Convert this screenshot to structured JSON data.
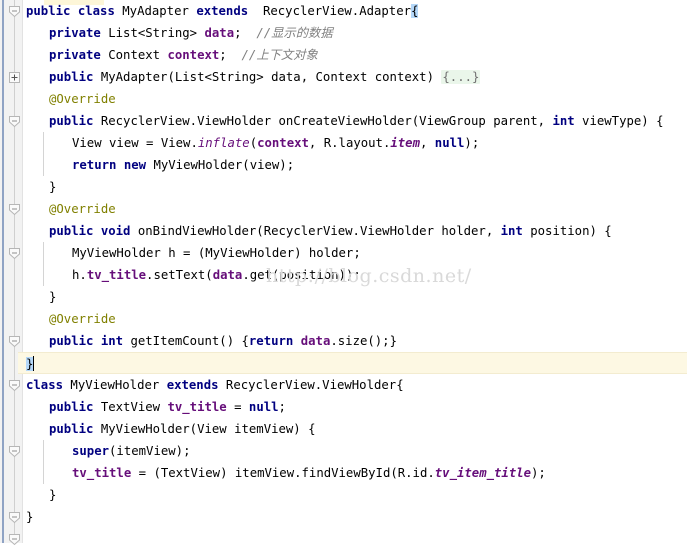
{
  "app": {
    "name": "code-editor",
    "language": "Java",
    "file_kind": "java-source"
  },
  "watermark": {
    "text": "http://blog.csdn.net/"
  },
  "gutter": {
    "fold_markers": [
      {
        "type": "expanded",
        "line": 0
      },
      {
        "type": "collapsed",
        "line": 3
      },
      {
        "type": "expanded",
        "line": 5
      },
      {
        "type": "expanded",
        "line": 9
      },
      {
        "type": "expanded",
        "line": 11
      },
      {
        "type": "expanded",
        "line": 15
      },
      {
        "type": "expanded",
        "line": 17
      },
      {
        "type": "expanded",
        "line": 20
      },
      {
        "type": "expanded",
        "line": 23
      },
      {
        "type": "expanded",
        "line": 24
      }
    ]
  },
  "code": {
    "caret_line_index": 17,
    "lines": [
      {
        "id": "l0",
        "indent": 0,
        "tokens": [
          {
            "t": "public",
            "c": "kw"
          },
          {
            "t": " ",
            "c": "pln"
          },
          {
            "t": "class",
            "c": "kw"
          },
          {
            "t": " ",
            "c": "pln"
          },
          {
            "t": "MyAdapter",
            "c": "pln"
          },
          {
            "t": " ",
            "c": "pln"
          },
          {
            "t": "extends",
            "c": "kw"
          },
          {
            "t": "  ",
            "c": "pln"
          },
          {
            "t": "RecyclerView.Adapter",
            "c": "pln"
          },
          {
            "t": "{",
            "c": "sel-brace"
          }
        ]
      },
      {
        "id": "l1",
        "indent": 1,
        "tokens": [
          {
            "t": "private",
            "c": "kw"
          },
          {
            "t": " List<String> ",
            "c": "pln"
          },
          {
            "t": "data",
            "c": "fld"
          },
          {
            "t": ";  ",
            "c": "pln"
          },
          {
            "t": "//显示的数据",
            "c": "cmt"
          }
        ]
      },
      {
        "id": "l2",
        "indent": 1,
        "tokens": [
          {
            "t": "private",
            "c": "kw"
          },
          {
            "t": " Context ",
            "c": "pln"
          },
          {
            "t": "context",
            "c": "fld"
          },
          {
            "t": ";  ",
            "c": "pln"
          },
          {
            "t": "//上下文对象",
            "c": "cmt"
          }
        ]
      },
      {
        "id": "l3",
        "indent": 1,
        "tokens": [
          {
            "t": "public",
            "c": "kw"
          },
          {
            "t": " MyAdapter(List<String> data, Context context) ",
            "c": "pln"
          },
          {
            "t": "{...}",
            "c": "fold-inline"
          }
        ]
      },
      {
        "id": "l4",
        "indent": 1,
        "tokens": [
          {
            "t": "@Override",
            "c": "ann"
          }
        ]
      },
      {
        "id": "l5",
        "indent": 1,
        "tokens": [
          {
            "t": "public",
            "c": "kw"
          },
          {
            "t": " RecyclerView.ViewHolder onCreateViewHolder(ViewGroup parent, ",
            "c": "pln"
          },
          {
            "t": "int",
            "c": "kw"
          },
          {
            "t": " viewType) {",
            "c": "pln"
          }
        ]
      },
      {
        "id": "l6",
        "indent": 2,
        "tokens": [
          {
            "t": "View view = View.",
            "c": "pln"
          },
          {
            "t": "inflate",
            "c": "sfi"
          },
          {
            "t": "(",
            "c": "pln"
          },
          {
            "t": "context",
            "c": "fld"
          },
          {
            "t": ", R.layout.",
            "c": "pln"
          },
          {
            "t": "item",
            "c": "fldi"
          },
          {
            "t": ", ",
            "c": "pln"
          },
          {
            "t": "null",
            "c": "kw"
          },
          {
            "t": ");",
            "c": "pln"
          }
        ]
      },
      {
        "id": "l7",
        "indent": 2,
        "tokens": [
          {
            "t": "return",
            "c": "kw"
          },
          {
            "t": " ",
            "c": "pln"
          },
          {
            "t": "new",
            "c": "kw"
          },
          {
            "t": " MyViewHolder(view);",
            "c": "pln"
          }
        ]
      },
      {
        "id": "l8",
        "indent": 1,
        "tokens": [
          {
            "t": "}",
            "c": "pln"
          }
        ]
      },
      {
        "id": "l9",
        "indent": 1,
        "tokens": [
          {
            "t": "@Override",
            "c": "ann"
          }
        ]
      },
      {
        "id": "l10",
        "indent": 1,
        "tokens": [
          {
            "t": "public",
            "c": "kw"
          },
          {
            "t": " ",
            "c": "pln"
          },
          {
            "t": "void",
            "c": "kw"
          },
          {
            "t": " onBindViewHolder(RecyclerView.ViewHolder holder, ",
            "c": "pln"
          },
          {
            "t": "int",
            "c": "kw"
          },
          {
            "t": " position) {",
            "c": "pln"
          }
        ]
      },
      {
        "id": "l11",
        "indent": 2,
        "tokens": [
          {
            "t": "MyViewHolder h = (MyViewHolder) holder;",
            "c": "pln"
          }
        ]
      },
      {
        "id": "l12",
        "indent": 2,
        "tokens": [
          {
            "t": "h.",
            "c": "pln"
          },
          {
            "t": "tv_title",
            "c": "fld"
          },
          {
            "t": ".setText(",
            "c": "pln"
          },
          {
            "t": "data",
            "c": "fld"
          },
          {
            "t": ".get(position));",
            "c": "pln"
          }
        ]
      },
      {
        "id": "l13",
        "indent": 1,
        "tokens": [
          {
            "t": "}",
            "c": "pln"
          }
        ]
      },
      {
        "id": "l14",
        "indent": 1,
        "tokens": [
          {
            "t": "@Override",
            "c": "ann"
          }
        ]
      },
      {
        "id": "l15",
        "indent": 1,
        "tokens": [
          {
            "t": "public",
            "c": "kw"
          },
          {
            "t": " ",
            "c": "pln"
          },
          {
            "t": "int",
            "c": "kw"
          },
          {
            "t": " getItemCount() {",
            "c": "pln"
          },
          {
            "t": "return",
            "c": "kw"
          },
          {
            "t": " ",
            "c": "pln"
          },
          {
            "t": "data",
            "c": "fld"
          },
          {
            "t": ".size();}",
            "c": "pln"
          }
        ]
      },
      {
        "id": "l16",
        "indent": 0,
        "caret": true,
        "tokens": [
          {
            "t": "}",
            "c": "sel-brace"
          }
        ]
      },
      {
        "id": "l17",
        "indent": 0,
        "tokens": [
          {
            "t": "class",
            "c": "kw"
          },
          {
            "t": " MyViewHolder ",
            "c": "pln"
          },
          {
            "t": "extends",
            "c": "kw"
          },
          {
            "t": " RecyclerView.ViewHolder{",
            "c": "pln"
          }
        ]
      },
      {
        "id": "l18",
        "indent": 1,
        "tokens": [
          {
            "t": "public",
            "c": "kw"
          },
          {
            "t": " TextView ",
            "c": "pln"
          },
          {
            "t": "tv_title",
            "c": "fld"
          },
          {
            "t": " = ",
            "c": "pln"
          },
          {
            "t": "null",
            "c": "kw"
          },
          {
            "t": ";",
            "c": "pln"
          }
        ]
      },
      {
        "id": "l19",
        "indent": 1,
        "tokens": [
          {
            "t": "public",
            "c": "kw"
          },
          {
            "t": " MyViewHolder(View itemView) {",
            "c": "pln"
          }
        ]
      },
      {
        "id": "l20",
        "indent": 2,
        "tokens": [
          {
            "t": "super",
            "c": "kw"
          },
          {
            "t": "(itemView);",
            "c": "pln"
          }
        ]
      },
      {
        "id": "l21",
        "indent": 2,
        "tokens": [
          {
            "t": "tv_title",
            "c": "fld"
          },
          {
            "t": " = (TextView) itemView.findViewById(R.id.",
            "c": "pln"
          },
          {
            "t": "tv_item_title",
            "c": "fldi"
          },
          {
            "t": ");",
            "c": "pln"
          }
        ]
      },
      {
        "id": "l22",
        "indent": 1,
        "tokens": [
          {
            "t": "}",
            "c": "pln"
          }
        ]
      },
      {
        "id": "l23",
        "indent": 0,
        "tokens": [
          {
            "t": "}",
            "c": "pln"
          }
        ]
      }
    ]
  },
  "colors": {
    "background": "#ffffff",
    "gutter": "#f2f2f2",
    "keyword": "#000080",
    "field": "#660e7a",
    "comment": "#808080",
    "annotation": "#808000",
    "caret_line": "#fdf8e3",
    "selection": "#b4d7f8",
    "folded_block": "#eaf6ea",
    "watermark": "#d9d9d9"
  }
}
